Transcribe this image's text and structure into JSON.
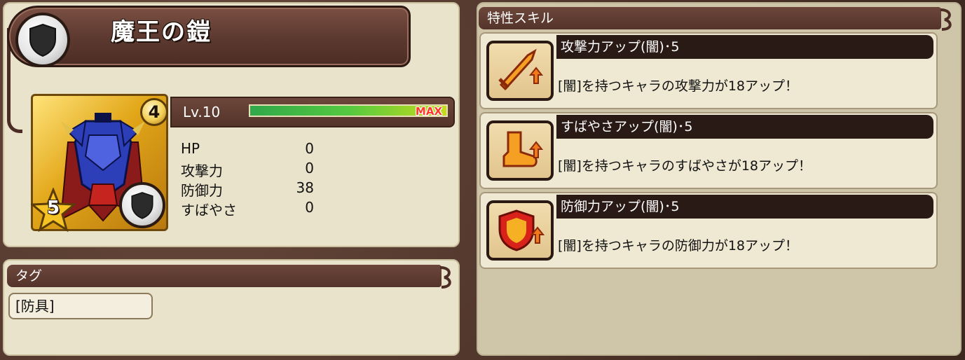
{
  "item": {
    "name": "魔王の鎧",
    "type_icon": "shield-icon",
    "rarity": "4",
    "stars": "5",
    "level_label": "Lv.10",
    "level_progress": 1.0,
    "max_label": "MAX"
  },
  "stats": [
    {
      "label": "HP",
      "value": "0"
    },
    {
      "label": "攻撃力",
      "value": "0"
    },
    {
      "label": "防御力",
      "value": "38"
    },
    {
      "label": "すばやさ",
      "value": "0"
    }
  ],
  "tags": {
    "header": "タグ",
    "items": [
      "[防具]"
    ]
  },
  "skills": {
    "header": "特性スキル",
    "items": [
      {
        "name": "攻撃力アップ(闇)･5",
        "description": "[闇]を持つキャラの攻撃力が18アップ！",
        "icon": "sword-up-icon"
      },
      {
        "name": "すばやさアップ(闇)･5",
        "description": "[闇]を持つキャラのすばやさが18アップ！",
        "icon": "boot-up-icon"
      },
      {
        "name": "防御力アップ(闇)･5",
        "description": "[闇]を持つキャラの防御力が18アップ！",
        "icon": "shield-up-icon"
      }
    ]
  },
  "colors": {
    "panel": "#e9e3cc",
    "header": "#5e3a30",
    "skill_name_bar": "#2a1a15",
    "max_text": "#ff3a2a"
  }
}
